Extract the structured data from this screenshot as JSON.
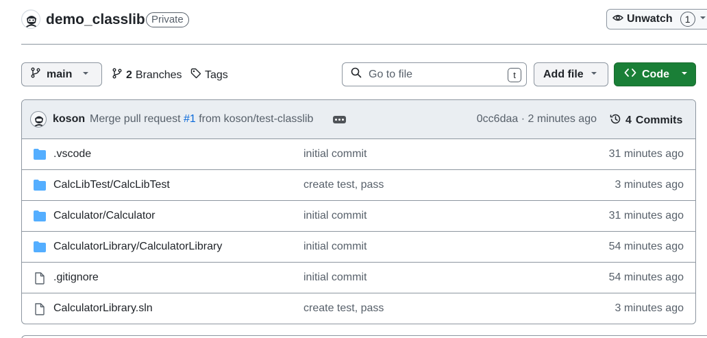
{
  "repo": {
    "name": "demo_classlib",
    "visibility": "Private"
  },
  "watch": {
    "label": "Unwatch",
    "count": "1"
  },
  "toolbar": {
    "branch": "main",
    "branches_count": "2",
    "branches_label": "Branches",
    "tags_label": "Tags",
    "search_placeholder": "Go to file",
    "search_shortcut": "t",
    "add_file_label": "Add file",
    "code_label": "Code"
  },
  "latest_commit": {
    "author": "koson",
    "message_prefix": "Merge pull request",
    "pr_number": "#1",
    "message_suffix": "from koson/test-classlib",
    "hash_time": "0cc6daa · 2 minutes ago",
    "commits_count": "4",
    "commits_label": "Commits"
  },
  "files": [
    {
      "name": ".vscode",
      "type": "folder",
      "message": "initial commit",
      "time": "31 minutes ago"
    },
    {
      "name": "CalcLibTest/CalcLibTest",
      "type": "folder",
      "message": "create test, pass",
      "time": "3 minutes ago"
    },
    {
      "name": "Calculator/Calculator",
      "type": "folder",
      "message": "initial commit",
      "time": "31 minutes ago"
    },
    {
      "name": "CalculatorLibrary/CalculatorLibrary",
      "type": "folder",
      "message": "initial commit",
      "time": "54 minutes ago"
    },
    {
      "name": ".gitignore",
      "type": "file",
      "message": "initial commit",
      "time": "54 minutes ago"
    },
    {
      "name": "CalculatorLibrary.sln",
      "type": "file",
      "message": "create test, pass",
      "time": "3 minutes ago"
    }
  ],
  "colors": {
    "accent": "#0969da",
    "folder": "#54aeff",
    "code_button": "#1a7f37"
  },
  "icons": [
    "repo-avatar-icon",
    "eye-icon",
    "branch-icon",
    "tag-icon",
    "search-icon",
    "code-icon",
    "history-icon",
    "folder-icon",
    "file-icon",
    "chevron-down-icon"
  ]
}
